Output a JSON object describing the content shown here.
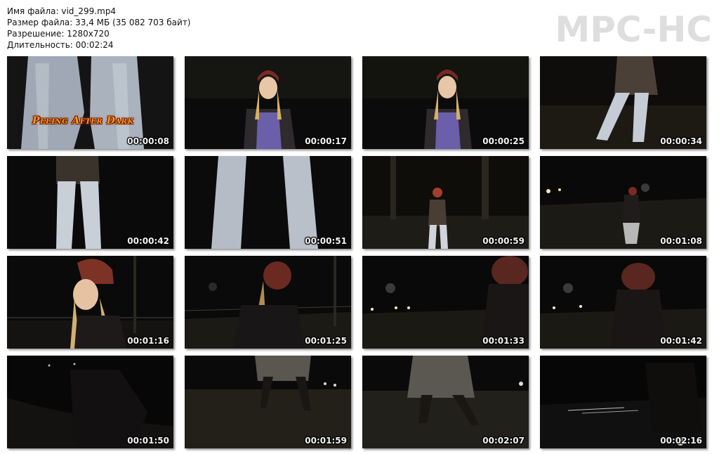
{
  "file_info": {
    "name_line": "Имя файла: vid_299.mp4",
    "size_line": "Размер файла: 33,4 МБ (35 082 703 байт)",
    "resolution_line": "Разрешение: 1280x720",
    "duration_line": "Длительность: 00:02:24"
  },
  "logo": "MPC-HC",
  "overlay_title": "Peeing After Dark",
  "thumbnails": [
    {
      "timestamp": "00:00:08"
    },
    {
      "timestamp": "00:00:17"
    },
    {
      "timestamp": "00:00:25"
    },
    {
      "timestamp": "00:00:34"
    },
    {
      "timestamp": "00:00:42"
    },
    {
      "timestamp": "00:00:51"
    },
    {
      "timestamp": "00:00:59"
    },
    {
      "timestamp": "00:01:08"
    },
    {
      "timestamp": "00:01:16"
    },
    {
      "timestamp": "00:01:25"
    },
    {
      "timestamp": "00:01:33"
    },
    {
      "timestamp": "00:01:42"
    },
    {
      "timestamp": "00:01:50"
    },
    {
      "timestamp": "00:01:59"
    },
    {
      "timestamp": "00:02:07"
    },
    {
      "timestamp": "00:02:16"
    }
  ]
}
